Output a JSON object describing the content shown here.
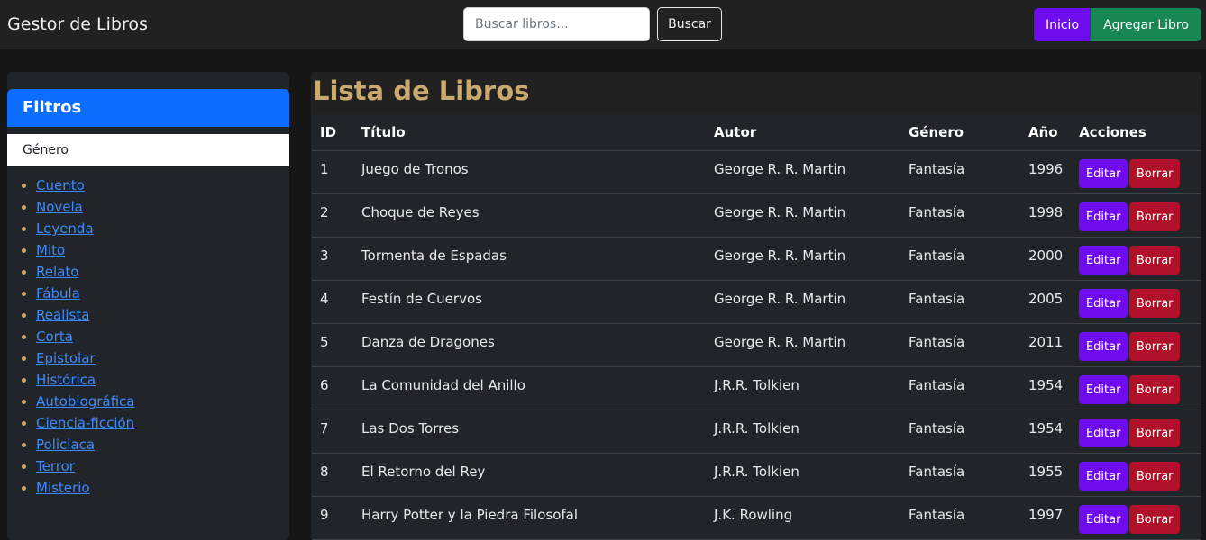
{
  "navbar": {
    "brand": "Gestor de Libros",
    "search_placeholder": "Buscar libros...",
    "search_button": "Buscar",
    "home_button": "Inicio",
    "add_button": "Agregar Libro"
  },
  "sidebar": {
    "title": "Filtros",
    "genre_header": "Género",
    "genres": [
      "Cuento",
      "Novela",
      "Leyenda",
      "Mito",
      "Relato",
      "Fábula",
      "Realista",
      "Corta",
      "Epistolar",
      "Histórica",
      "Autobiográfica",
      "Ciencia-ficción",
      "Policiaca",
      "Terror",
      "Misterio"
    ]
  },
  "main": {
    "title": "Lista de Libros",
    "columns": [
      "ID",
      "Título",
      "Autor",
      "Género",
      "Año",
      "Acciones"
    ],
    "edit_label": "Editar",
    "delete_label": "Borrar",
    "rows": [
      {
        "id": "1",
        "title": "Juego de Tronos",
        "author": "George R. R. Martin",
        "genre": "Fantasía",
        "year": "1996"
      },
      {
        "id": "2",
        "title": "Choque de Reyes",
        "author": "George R. R. Martin",
        "genre": "Fantasía",
        "year": "1998"
      },
      {
        "id": "3",
        "title": "Tormenta de Espadas",
        "author": "George R. R. Martin",
        "genre": "Fantasía",
        "year": "2000"
      },
      {
        "id": "4",
        "title": "Festín de Cuervos",
        "author": "George R. R. Martin",
        "genre": "Fantasía",
        "year": "2005"
      },
      {
        "id": "5",
        "title": "Danza de Dragones",
        "author": "George R. R. Martin",
        "genre": "Fantasía",
        "year": "2011"
      },
      {
        "id": "6",
        "title": "La Comunidad del Anillo",
        "author": "J.R.R. Tolkien",
        "genre": "Fantasía",
        "year": "1954"
      },
      {
        "id": "7",
        "title": "Las Dos Torres",
        "author": "J.R.R. Tolkien",
        "genre": "Fantasía",
        "year": "1954"
      },
      {
        "id": "8",
        "title": "El Retorno del Rey",
        "author": "J.R.R. Tolkien",
        "genre": "Fantasía",
        "year": "1955"
      },
      {
        "id": "9",
        "title": "Harry Potter y la Piedra Filosofal",
        "author": "J.K. Rowling",
        "genre": "Fantasía",
        "year": "1997"
      }
    ]
  },
  "colors": {
    "primary": "#0d6efd",
    "accent_purple": "#6f0cee",
    "success": "#198754",
    "danger": "#b0102a",
    "title_gold": "#c9a96e"
  }
}
